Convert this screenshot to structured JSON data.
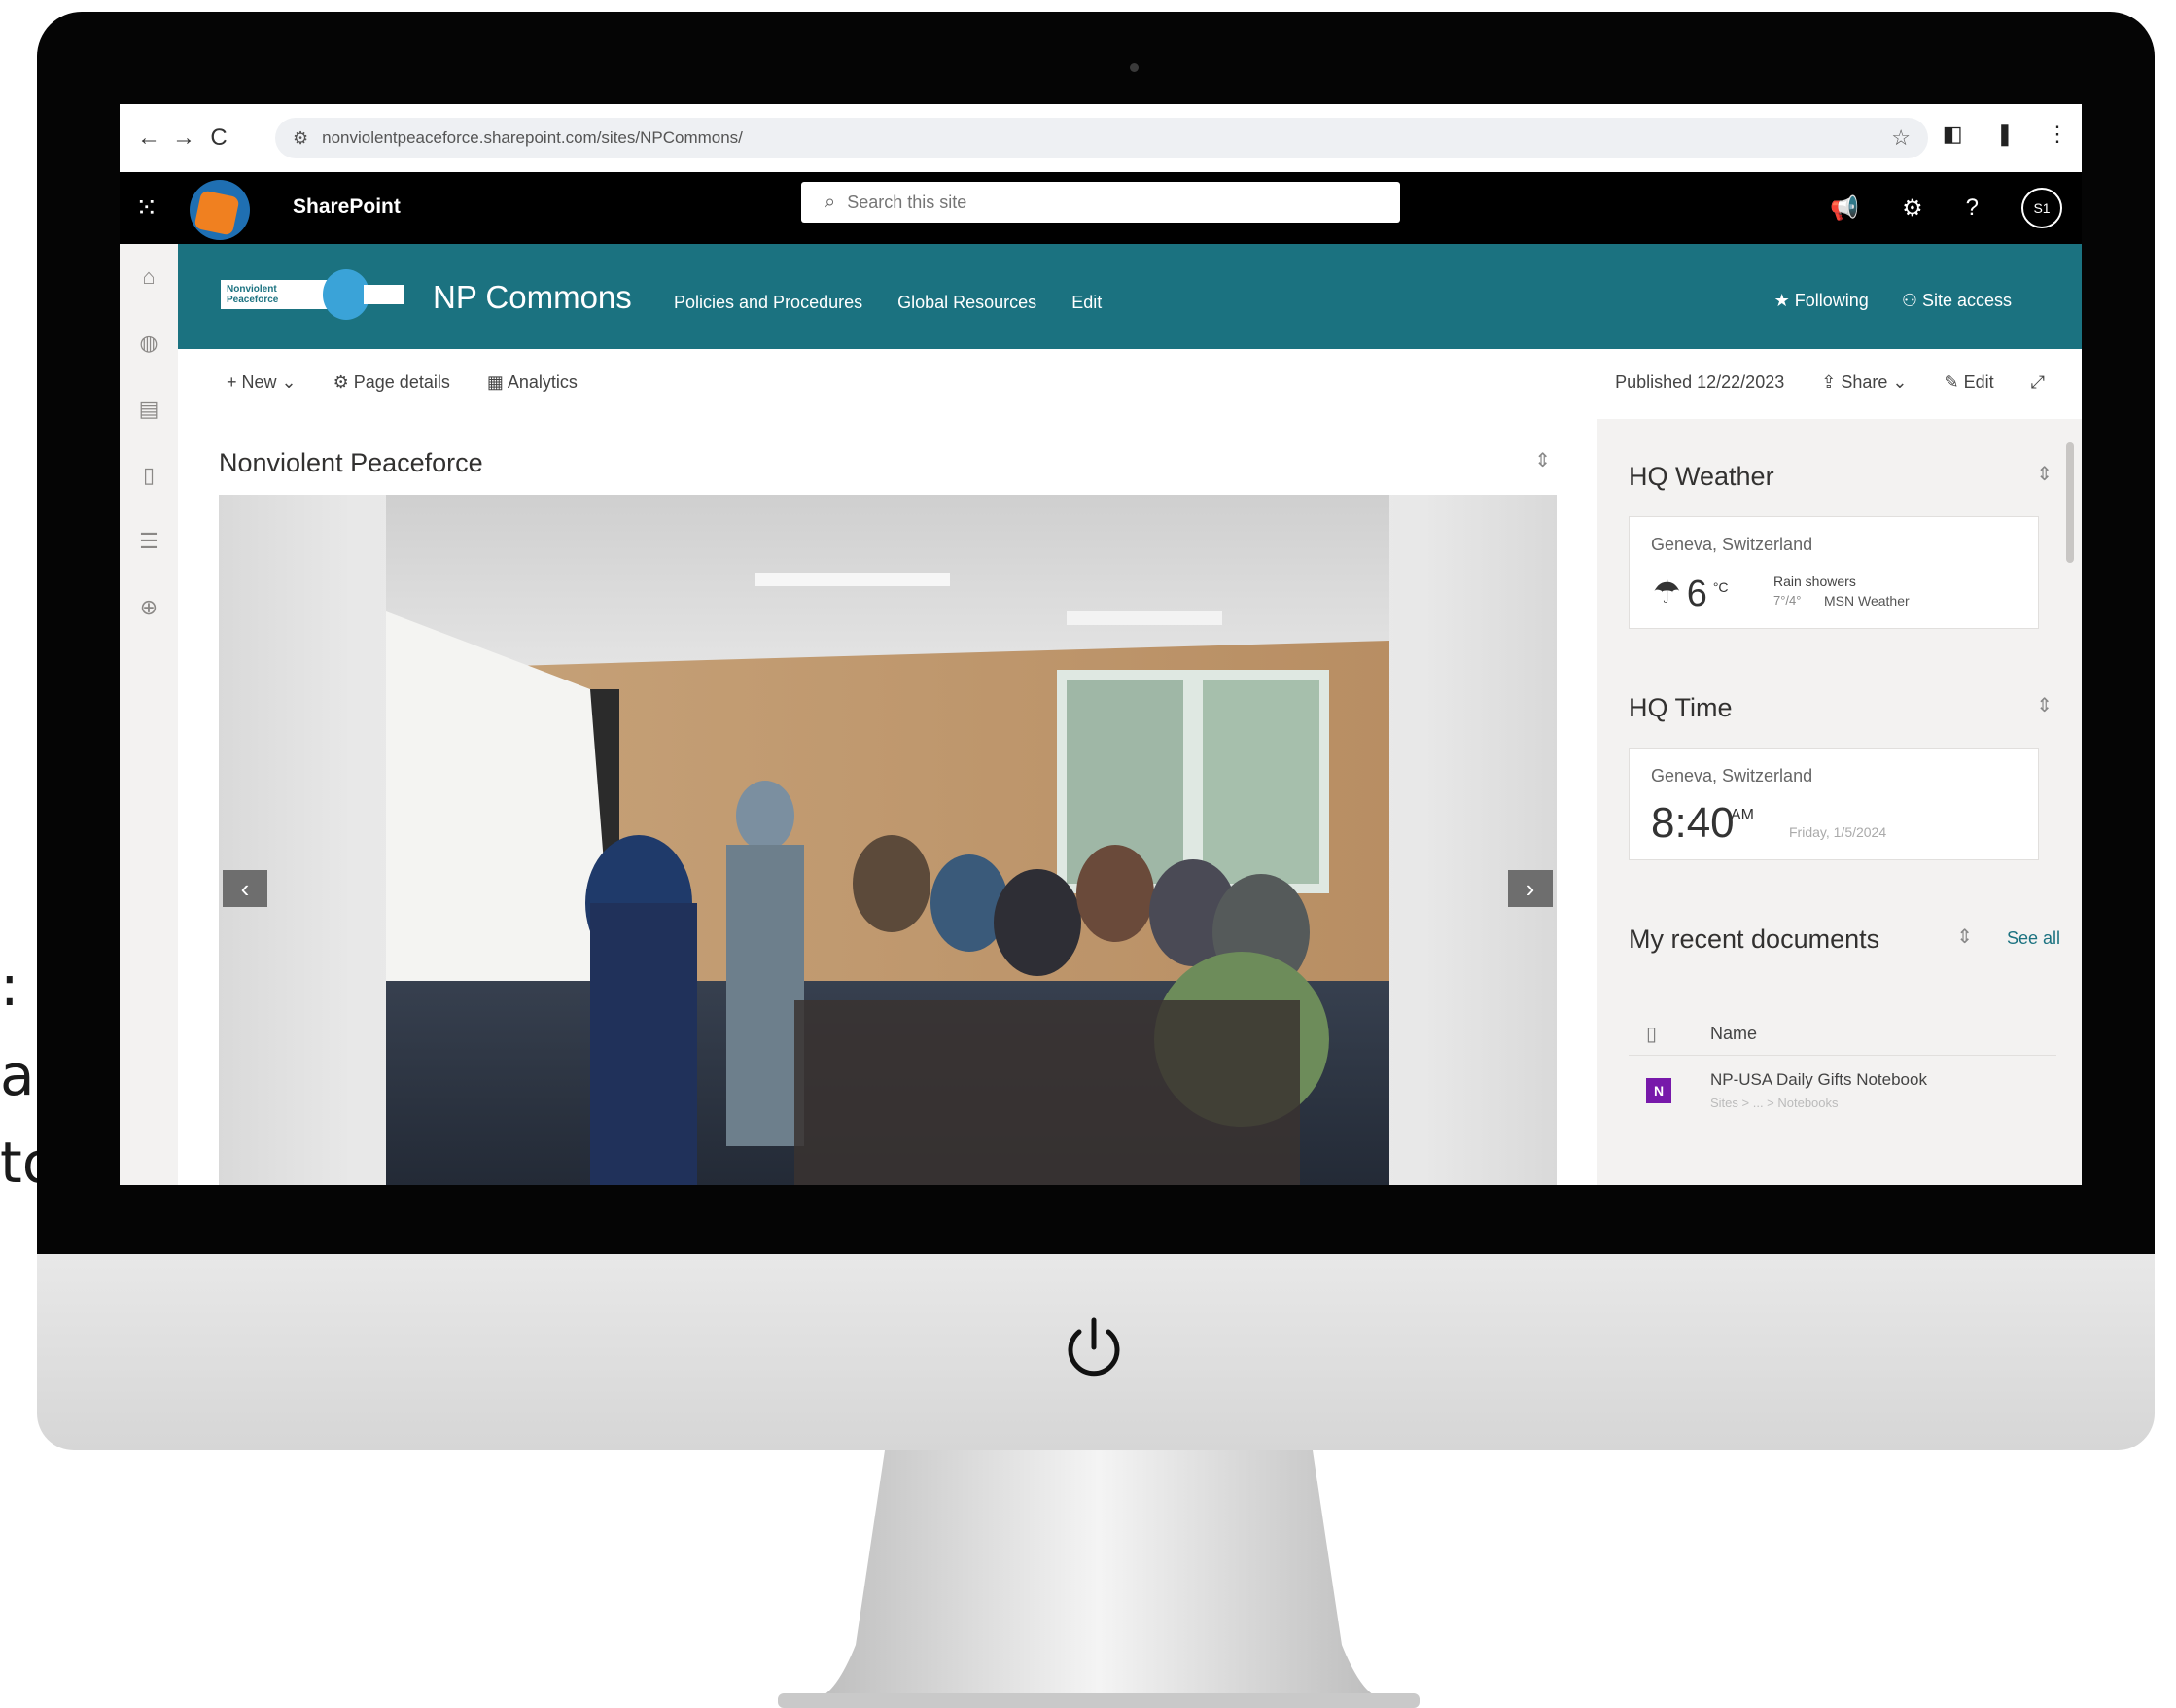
{
  "side_text": [
    ":",
    "all",
    "to"
  ],
  "browser": {
    "url": "nonviolentpeaceforce.sharepoint.com/sites/NPCommons/",
    "back": "←",
    "forward": "→",
    "reload": "C"
  },
  "suitebar": {
    "app_name": "SharePoint",
    "search_placeholder": "Search this site",
    "avatar_initials": "S1"
  },
  "site": {
    "logo_text": "Nonviolent Peaceforce",
    "title": "NP Commons",
    "nav": [
      "Policies and Procedures",
      "Global Resources",
      "Edit"
    ],
    "following": "Following",
    "site_access": "Site access"
  },
  "command_bar": {
    "new": "New",
    "page_details": "Page details",
    "analytics": "Analytics",
    "published": "Published 12/22/2023",
    "share": "Share",
    "edit": "Edit"
  },
  "main": {
    "section_title": "Nonviolent Peaceforce"
  },
  "weather": {
    "title": "HQ Weather",
    "location": "Geneva, Switzerland",
    "temperature": "6",
    "unit": "°C",
    "condition": "Rain showers",
    "range": "7°/4°",
    "source": "MSN Weather"
  },
  "time": {
    "title": "HQ Time",
    "location": "Geneva, Switzerland",
    "clock": "8:40",
    "ampm": "AM",
    "date": "Friday, 1/5/2024"
  },
  "recent_docs": {
    "title": "My recent documents",
    "see_all": "See all",
    "column_name": "Name",
    "items": [
      {
        "name": "NP-USA Daily Gifts Notebook",
        "path": "Sites > ... > Notebooks"
      }
    ]
  }
}
